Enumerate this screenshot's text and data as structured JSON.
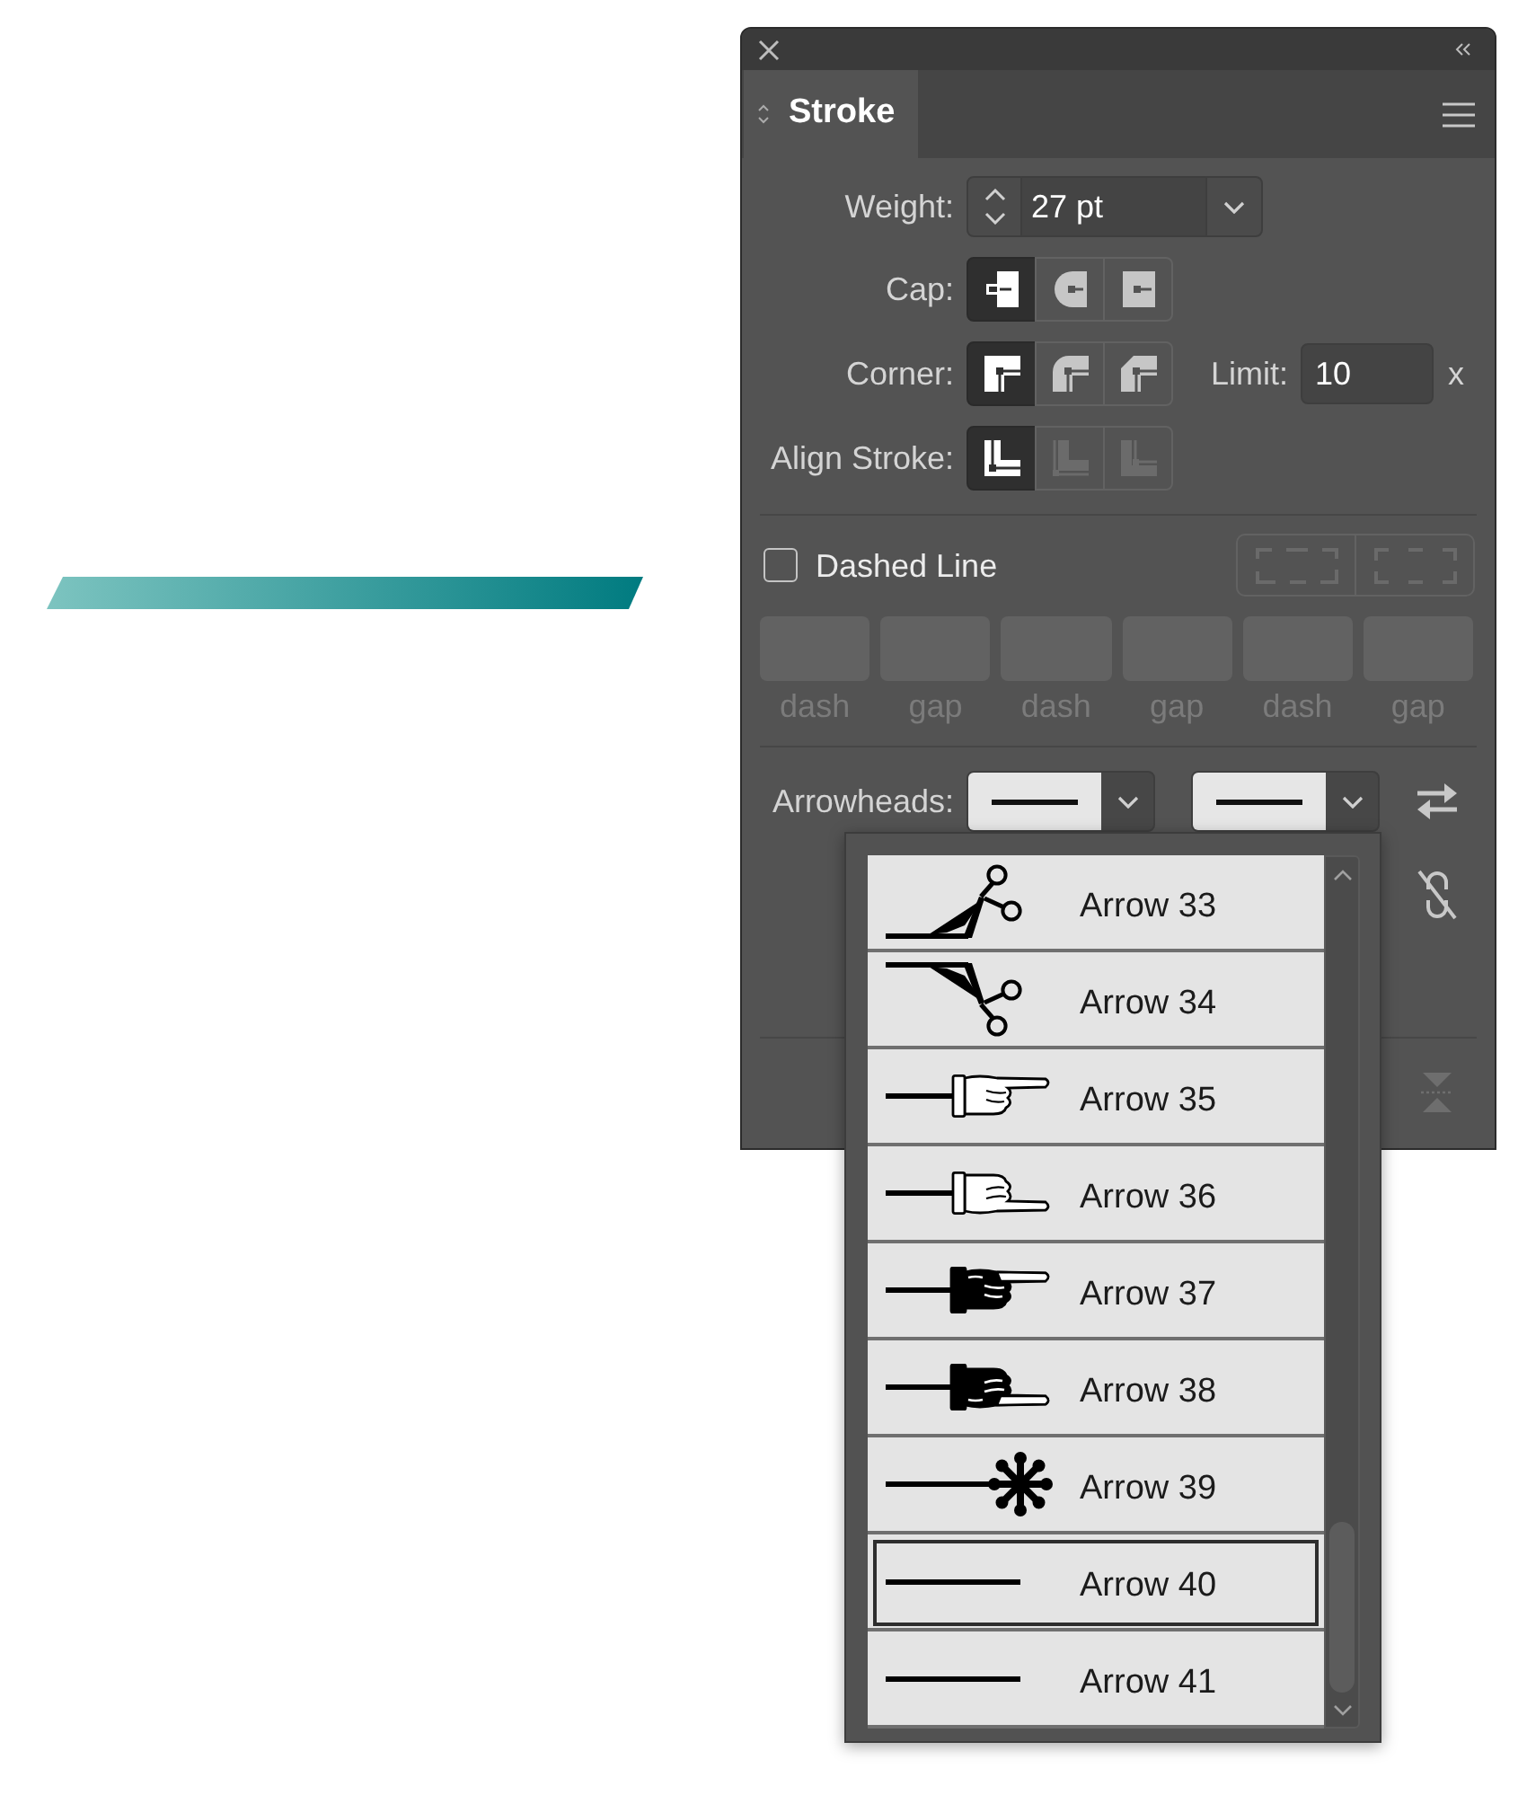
{
  "panel": {
    "tab": {
      "label": "Stroke",
      "selected": true
    },
    "weight": {
      "label": "Weight:",
      "value": "27 pt"
    },
    "cap": {
      "label": "Cap:",
      "options": [
        {
          "kind": "butt",
          "selected": true
        },
        {
          "kind": "round",
          "selected": false
        },
        {
          "kind": "projecting",
          "selected": false
        }
      ]
    },
    "corner": {
      "label": "Corner:",
      "options": [
        {
          "kind": "miter",
          "selected": true
        },
        {
          "kind": "round",
          "selected": false
        },
        {
          "kind": "bevel",
          "selected": false
        }
      ]
    },
    "limit": {
      "label": "Limit:",
      "value": "10",
      "unit": "x"
    },
    "align_stroke": {
      "label": "Align Stroke:",
      "options": [
        {
          "kind": "center",
          "selected": true,
          "disabled": false
        },
        {
          "kind": "inside",
          "selected": false,
          "disabled": true
        },
        {
          "kind": "outside",
          "selected": false,
          "disabled": true
        }
      ]
    },
    "dashed_line": {
      "label": "Dashed Line",
      "checked": false
    },
    "dash_alignment": [
      {
        "kind": "preserve",
        "disabled": true
      },
      {
        "kind": "align",
        "disabled": true
      }
    ],
    "dash_fields": [
      {
        "label": "dash",
        "disabled": true
      },
      {
        "label": "gap",
        "disabled": true
      },
      {
        "label": "dash",
        "disabled": true
      },
      {
        "label": "gap",
        "disabled": true
      },
      {
        "label": "dash",
        "disabled": true
      },
      {
        "label": "gap",
        "disabled": true
      }
    ],
    "arrowheads": {
      "label": "Arrowheads:",
      "start": {
        "kind": "line"
      },
      "end": {
        "kind": "line"
      }
    }
  },
  "arrowhead_menu": {
    "items": [
      {
        "label": "Arrow 33",
        "kind": "scissors_up",
        "selected": false
      },
      {
        "label": "Arrow 34",
        "kind": "scissors_down",
        "selected": false
      },
      {
        "label": "Arrow 35",
        "kind": "hand",
        "selected": false
      },
      {
        "label": "Arrow 36",
        "kind": "hand_down",
        "selected": false
      },
      {
        "label": "Arrow 37",
        "kind": "dark_hand",
        "selected": false
      },
      {
        "label": "Arrow 38",
        "kind": "dark_hand_down",
        "selected": false
      },
      {
        "label": "Arrow 39",
        "kind": "asterisk",
        "selected": false
      },
      {
        "label": "Arrow 40",
        "kind": "line",
        "selected": true
      },
      {
        "label": "Arrow 41",
        "kind": "line",
        "selected": false
      }
    ]
  }
}
